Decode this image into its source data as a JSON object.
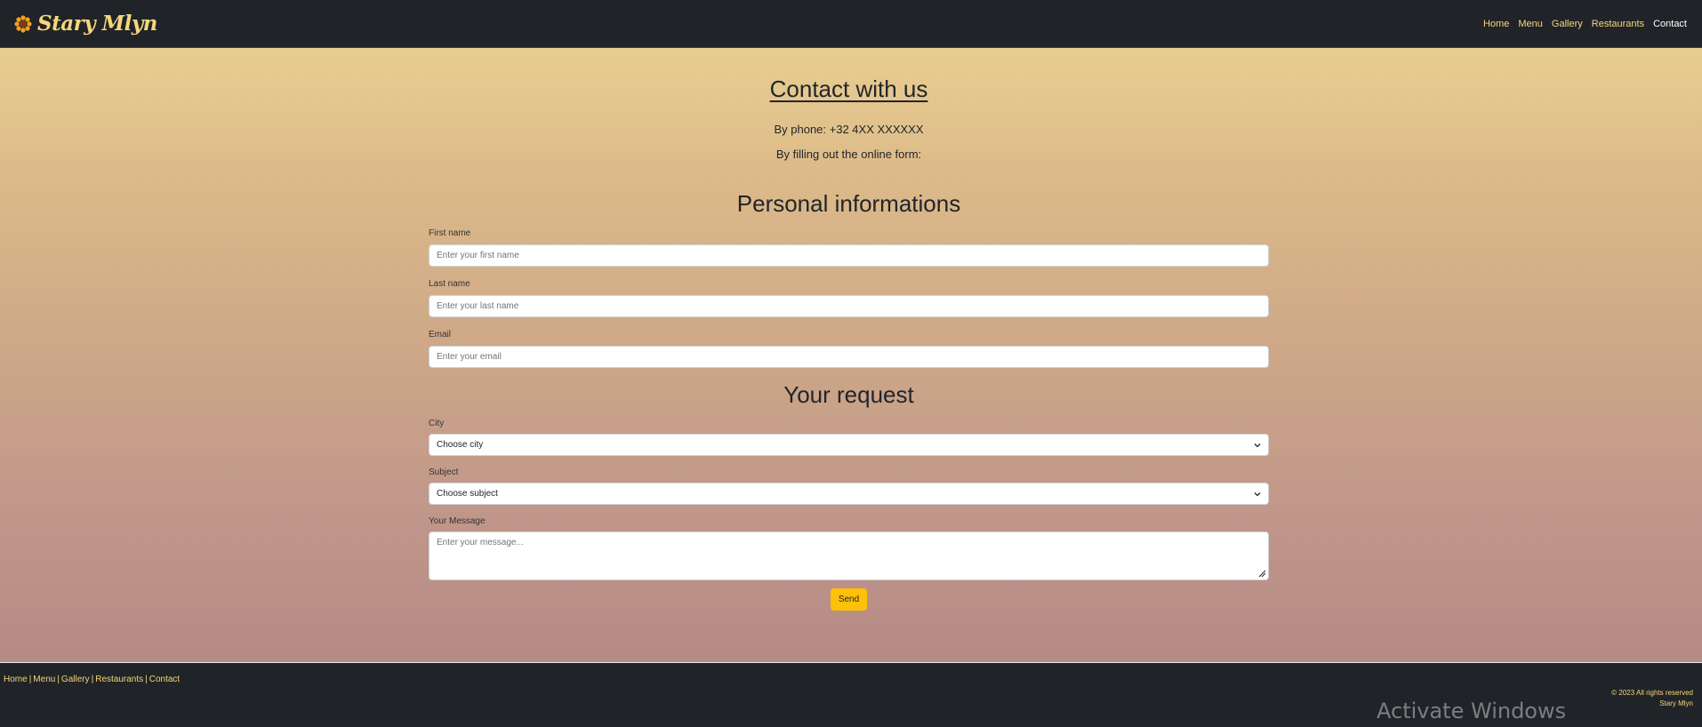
{
  "navbar": {
    "brand": "Stary Mlyn",
    "brand_icon": "sunflower-icon",
    "links": [
      {
        "label": "Home"
      },
      {
        "label": "Menu"
      },
      {
        "label": "Gallery"
      },
      {
        "label": "Restaurants"
      },
      {
        "label": "Contact",
        "active": true
      }
    ]
  },
  "contact": {
    "title": "Contact with us",
    "phone_line": "By phone: +32 4XX XXXXXX",
    "form_line": "By filling out the online form:"
  },
  "personal": {
    "heading": "Personal informations",
    "first_name": {
      "label": "First name",
      "placeholder": "Enter your first name"
    },
    "last_name": {
      "label": "Last name",
      "placeholder": "Enter your last name"
    },
    "email": {
      "label": "Email",
      "placeholder": "Enter your email"
    }
  },
  "request": {
    "heading": "Your request",
    "city": {
      "label": "City",
      "value": "Choose city"
    },
    "subject": {
      "label": "Subject",
      "value": "Choose subject"
    },
    "message": {
      "label": "Your Message",
      "placeholder": "Enter your message..."
    },
    "send_label": "Send"
  },
  "footer": {
    "links": [
      "Home",
      "Menu",
      "Gallery",
      "Restaurants",
      "Contact"
    ],
    "copyright": "© 2023 All rights reserved",
    "company": "Stary Mlyn"
  },
  "watermark": "Activate Windows",
  "colors": {
    "dark": "#202328",
    "accent": "#f5d77a",
    "button": "#ffc107",
    "gradient_top": "#e8ce90",
    "gradient_bottom": "#b68a85"
  }
}
